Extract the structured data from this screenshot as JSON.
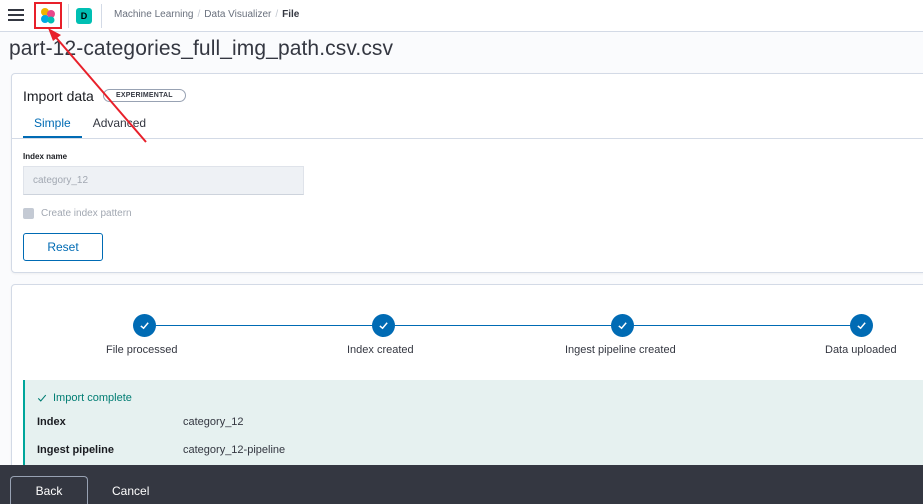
{
  "header": {
    "space_initial": "D",
    "breadcrumbs": [
      "Machine Learning",
      "Data Visualizer",
      "File"
    ],
    "separator": "/"
  },
  "page": {
    "title": "part-12-categories_full_img_path.csv.csv"
  },
  "import_panel": {
    "title": "Import data",
    "badge": "EXPERIMENTAL",
    "tabs": [
      {
        "label": "Simple",
        "active": true
      },
      {
        "label": "Advanced",
        "active": false
      }
    ],
    "index_name_label": "Index name",
    "index_name_value": "category_12",
    "create_index_pattern_label": "Create index pattern",
    "reset_label": "Reset"
  },
  "progress": {
    "steps": [
      {
        "label": "File processed",
        "complete": true
      },
      {
        "label": "Index created",
        "complete": true
      },
      {
        "label": "Ingest pipeline created",
        "complete": true
      },
      {
        "label": "Data uploaded",
        "complete": true
      }
    ],
    "callout_title": "Import complete",
    "details": [
      {
        "key": "Index",
        "value": "category_12"
      },
      {
        "key": "Ingest pipeline",
        "value": "category_12-pipeline"
      }
    ]
  },
  "bottom_bar": {
    "back_label": "Back",
    "cancel_label": "Cancel"
  },
  "colors": {
    "accent": "#006bb4",
    "success": "#017d73",
    "annotation": "#e8202a"
  },
  "icons": [
    "menu-icon",
    "elastic-logo-icon",
    "check-icon"
  ]
}
